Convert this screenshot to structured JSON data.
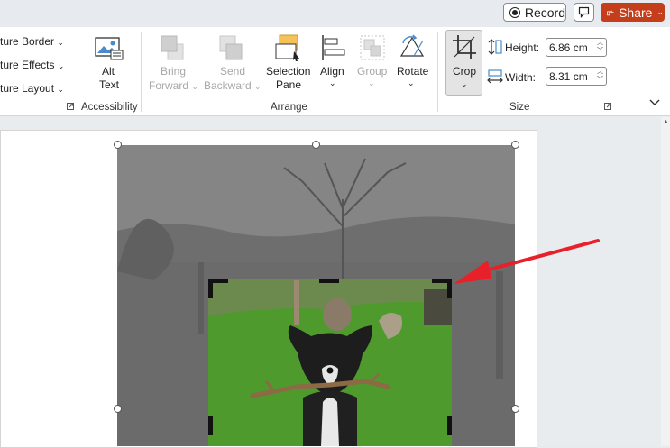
{
  "topbar": {
    "record_label": "Record",
    "share_label": "Share"
  },
  "ribbon": {
    "picture_styles": [
      "ture Border",
      "ture Effects",
      "ture Layout"
    ],
    "alt_text": {
      "line1": "Alt",
      "line2": "Text"
    },
    "accessibility_label": "Accessibility",
    "arrange": {
      "bring_forward": [
        "Bring",
        "Forward"
      ],
      "send_backward": [
        "Send",
        "Backward"
      ],
      "selection_pane": [
        "Selection",
        "Pane"
      ],
      "align": "Align",
      "group": "Group",
      "rotate": "Rotate",
      "label": "Arrange"
    },
    "crop_label": "Crop",
    "size": {
      "height_label": "Height:",
      "height_value": "6.86 cm",
      "width_label": "Width:",
      "width_value": "8.31 cm",
      "label": "Size"
    }
  },
  "colors": {
    "share": "#c43e1c",
    "arrow": "#e8202a",
    "grass": "#4f9a2c"
  }
}
